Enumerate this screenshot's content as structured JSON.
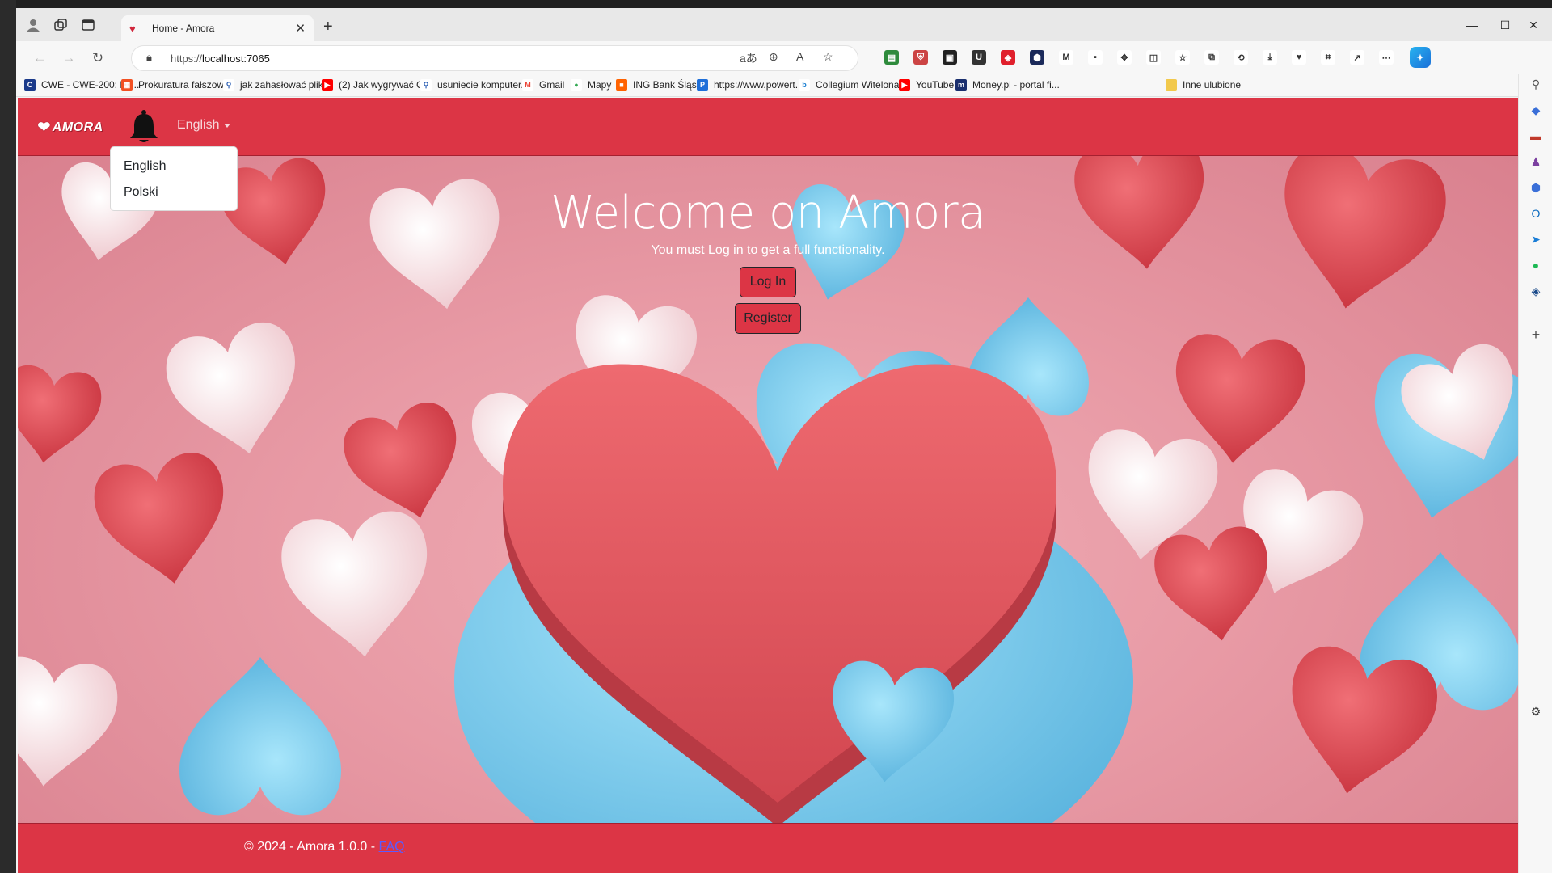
{
  "browser": {
    "tab_title": "Home - Amora",
    "url_prefix": "https://",
    "url_host": "localhost:7065",
    "bookmarks": [
      {
        "label": "CWE - CWE-200: Ex...",
        "color": "#1a3a8a"
      },
      {
        "label": "Prokuratura fałszow...",
        "color": "#f25022"
      },
      {
        "label": "jak zahasłować plik...",
        "color": "#2b5fb4"
      },
      {
        "label": "(2) Jak wygrywać C...",
        "color": "#ff0000"
      },
      {
        "label": "usuniecie komputer...",
        "color": "#2b5fb4"
      },
      {
        "label": "Gmail",
        "color": "#ea4335"
      },
      {
        "label": "Mapy",
        "color": "#34a853"
      },
      {
        "label": "ING Bank Śląski",
        "color": "#ff6200"
      },
      {
        "label": "https://www.powert...",
        "color": "#1e6fd9"
      },
      {
        "label": "Collegium Witelona...",
        "color": "#1b7fd1"
      },
      {
        "label": "YouTube",
        "color": "#ff0000"
      },
      {
        "label": "Money.pl - portal fi...",
        "color": "#1a2f6e"
      }
    ],
    "other_favorites": "Inne ulubione"
  },
  "site": {
    "brand": "AMORA",
    "language_toggle": "English",
    "language_options": [
      "English",
      "Polski"
    ],
    "hero_title": "Welcome on Amora",
    "hero_subtitle": "You must Log in to get a full functionality.",
    "login_label": "Log In",
    "register_label": "Register",
    "footer_text": "© 2024 - Amora 1.0.0 - ",
    "footer_link": "FAQ"
  },
  "colors": {
    "primary": "#dc3545",
    "hero_pink": "#e89aa5",
    "heart_red": "#e0555f",
    "heart_blue": "#7fd0ef",
    "heart_white": "#f6e3e6"
  }
}
